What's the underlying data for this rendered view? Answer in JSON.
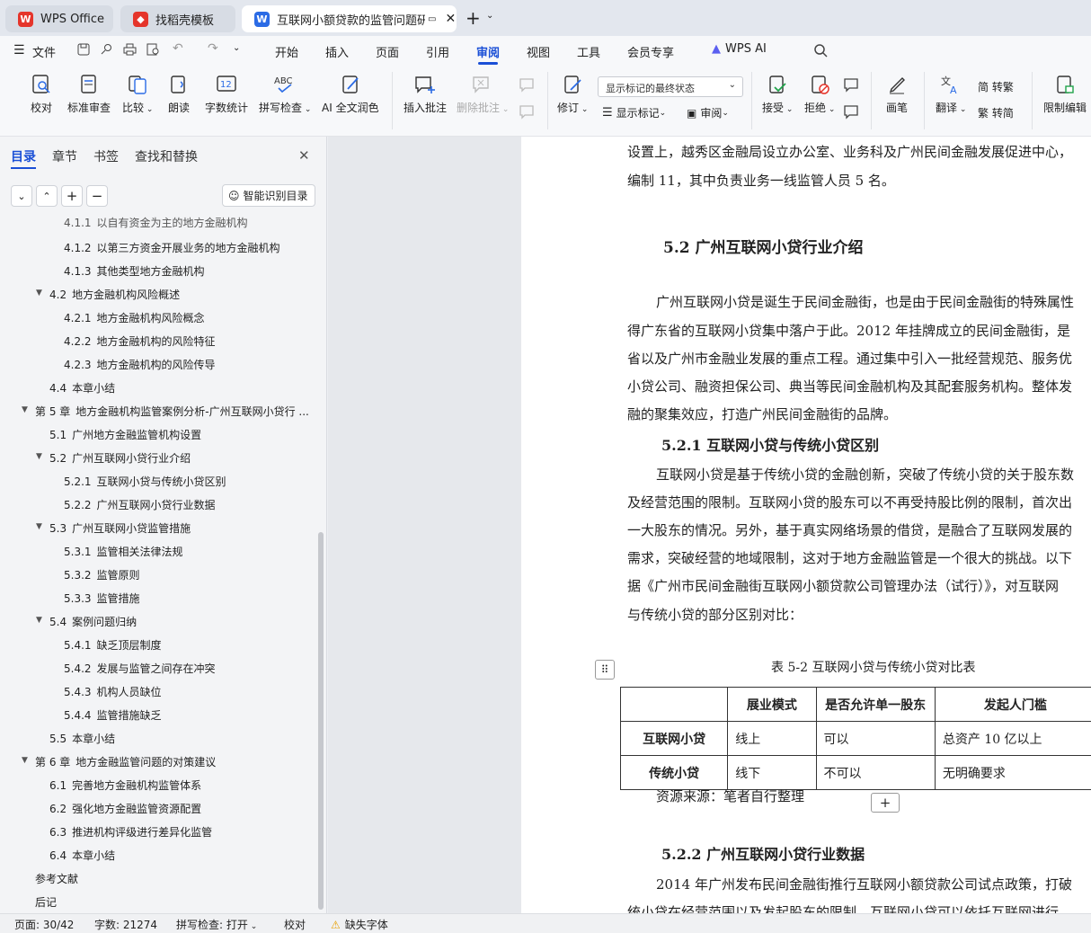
{
  "tabs": [
    {
      "label": "WPS Office"
    },
    {
      "label": "找稻壳模板"
    },
    {
      "label": "互联网小额贷款的监管问题研究"
    }
  ],
  "menu": {
    "file": "文件",
    "items": [
      "开始",
      "插入",
      "页面",
      "引用",
      "审阅",
      "视图",
      "工具",
      "会员专享"
    ],
    "wps_ai": "WPS AI"
  },
  "ribbon": {
    "proofread": "校对",
    "std_review": "标准审查",
    "compare": "比较",
    "read_aloud": "朗读",
    "word_count": "字数统计",
    "spell_check": "拼写检查",
    "ai_polish": "AI 全文润色",
    "insert_comment": "插入批注",
    "delete_comment": "删除批注",
    "track": "修订",
    "show_marks": "显示标记",
    "review": "审阅",
    "accept": "接受",
    "reject": "拒绝",
    "pen": "画笔",
    "translate": "翻译",
    "to_trad": "简 转繁",
    "to_simp": "繁 转简",
    "restrict_edit": "限制编辑",
    "display_mode": "显示标记的最终状态"
  },
  "sidebar": {
    "tabs": [
      "目录",
      "章节",
      "书签",
      "查找和替换"
    ],
    "smart_toc": "智能识别目录"
  },
  "toc": [
    {
      "num": "4.1.1",
      "text": "以自有资金为主的地方金融机构"
    },
    {
      "num": "4.1.2",
      "text": "以第三方资金开展业务的地方金融机构"
    },
    {
      "num": "4.1.3",
      "text": "其他类型地方金融机构"
    },
    {
      "num": "4.2",
      "text": "地方金融机构风险概述"
    },
    {
      "num": "4.2.1",
      "text": "地方金融机构风险概念"
    },
    {
      "num": "4.2.2",
      "text": "地方金融机构的风险特征"
    },
    {
      "num": "4.2.3",
      "text": "地方金融机构的风险传导"
    },
    {
      "num": "4.4",
      "text": "本章小结"
    },
    {
      "num": "第 5 章",
      "text": "地方金融机构监管案例分析-广州互联网小贷行 ..."
    },
    {
      "num": "5.1",
      "text": "广州地方金融监管机构设置"
    },
    {
      "num": "5.2",
      "text": "广州互联网小贷行业介绍"
    },
    {
      "num": "5.2.1",
      "text": "互联网小贷与传统小贷区别"
    },
    {
      "num": "5.2.2",
      "text": "广州互联网小贷行业数据"
    },
    {
      "num": "5.3",
      "text": "广州互联网小贷监管措施"
    },
    {
      "num": "5.3.1",
      "text": "监管相关法律法规"
    },
    {
      "num": "5.3.2",
      "text": "监管原则"
    },
    {
      "num": "5.3.3",
      "text": "监管措施"
    },
    {
      "num": "5.4",
      "text": "案例问题归纳"
    },
    {
      "num": "5.4.1",
      "text": "缺乏顶层制度"
    },
    {
      "num": "5.4.2",
      "text": "发展与监管之间存在冲突"
    },
    {
      "num": "5.4.3",
      "text": "机构人员缺位"
    },
    {
      "num": "5.4.4",
      "text": "监管措施缺乏"
    },
    {
      "num": "5.5",
      "text": "本章小结"
    },
    {
      "num": "第 6 章",
      "text": "地方金融监管问题的对策建议"
    },
    {
      "num": "6.1",
      "text": "完善地方金融机构监管体系"
    },
    {
      "num": "6.2",
      "text": "强化地方金融监管资源配置"
    },
    {
      "num": "6.3",
      "text": "推进机构评级进行差异化监管"
    },
    {
      "num": "6.4",
      "text": "本章小结"
    },
    {
      "num": "",
      "text": "参考文献"
    },
    {
      "num": "",
      "text": "后记"
    }
  ],
  "doc": {
    "p0": [
      "设置上，越秀区金融局设立办公室、业务科及广州民间金融发展促进中心，",
      "编制 11，其中负责业务一线监管人员 5 名。"
    ],
    "h52": "5.2  广州互联网小贷行业介绍",
    "p1": [
      "广州互联网小贷是诞生于民间金融街，也是由于民间金融街的特殊属性",
      "得广东省的互联网小贷集中落户于此。2012 年挂牌成立的民间金融街，是",
      "省以及广州市金融业发展的重点工程。通过集中引入一批经营规范、服务优",
      "小贷公司、融资担保公司、典当等民间金融机构及其配套服务机构。整体发",
      "融的聚集效应，打造广州民间金融街的品牌。"
    ],
    "h521": "5.2.1  互联网小贷与传统小贷区别",
    "p2": [
      "互联网小贷是基于传统小贷的金融创新，突破了传统小贷的关于股东数",
      "及经营范围的限制。互联网小贷的股东可以不再受持股比例的限制，首次出",
      "一大股东的情况。另外，基于真实网络场景的借贷，是融合了互联网发展的",
      "需求，突破经营的地域限制，这对于地方金融监管是一个很大的挑战。以下",
      "据《广州市民间金融街互联网小额贷款公司管理办法（试行）》，对互联网",
      "与传统小贷的部分区别对比："
    ],
    "table_caption": "表 5-2    互联网小贷与传统小贷对比表",
    "table": {
      "header": [
        "",
        "展业模式",
        "是否允许单一股东",
        "发起人门槛"
      ],
      "rows": [
        [
          "互联网小贷",
          "线上",
          "可以",
          "总资产 10 亿以上"
        ],
        [
          "传统小贷",
          "线下",
          "不可以",
          "无明确要求"
        ]
      ]
    },
    "source": "资源来源：笔者自行整理",
    "h522": "5.2.2  广州互联网小贷行业数据",
    "p3": [
      "2014 年广州发布民间金融街推行互联网小额贷款公司试点政策，打破",
      "统小贷在经营范围以及发起股东的限制，互联网小贷可以依托互联网进行"
    ]
  },
  "status": {
    "page": "页面: 30/42",
    "words": "字数: 21274",
    "spell": "拼写检查: 打开",
    "proof": "校对",
    "font": "缺失字体"
  }
}
